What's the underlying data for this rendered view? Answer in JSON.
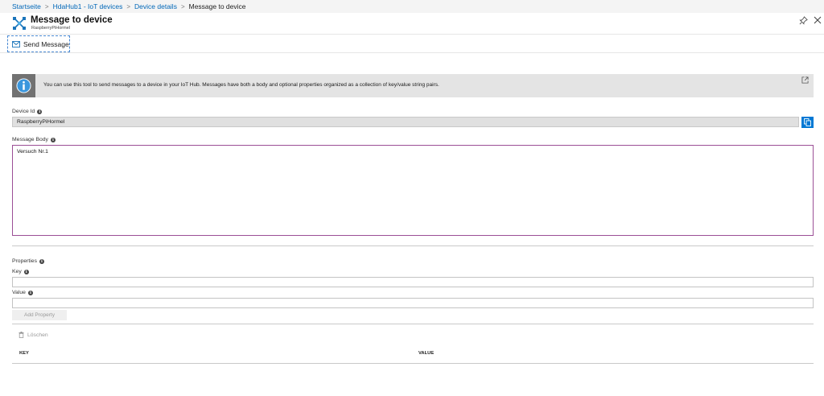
{
  "breadcrumb": {
    "items": [
      "Startseite",
      "HdaHub1 - IoT devices",
      "Device details"
    ],
    "current": "Message to device"
  },
  "blade": {
    "title": "Message to device",
    "subtitle": "RaspberryPiHormel",
    "icon": "iot-device-icon"
  },
  "toolbar": {
    "send_label": "Send Message"
  },
  "info": {
    "text": "You can use this tool to send messages to a device in your IoT Hub. Messages have both a body and optional properties organized as a collection of key/value string pairs."
  },
  "device_id": {
    "label": "Device Id",
    "value": "RaspberryPiHormel"
  },
  "message_body": {
    "label": "Message Body",
    "value": "Versuch Nr.1"
  },
  "properties": {
    "label": "Properties",
    "key_label": "Key",
    "key_value": "",
    "value_label": "Value",
    "value_value": "",
    "add_label": "Add Property",
    "delete_label": "Löschen",
    "columns": [
      "KEY",
      "VALUE"
    ]
  },
  "colors": {
    "accent": "#0078d4",
    "body_border": "#9b4f96",
    "info_bg": "#e4e4e4"
  }
}
